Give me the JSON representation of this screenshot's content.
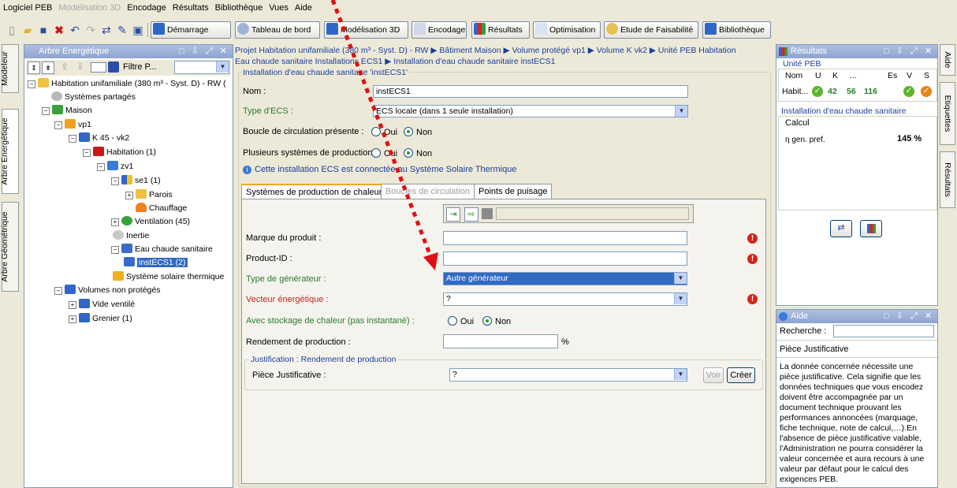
{
  "menu": {
    "items": [
      "Logiciel PEB",
      "Modélisation 3D",
      "Encodage",
      "Résultats",
      "Bibliothèque",
      "Vues",
      "Aide"
    ],
    "disabled": [
      false,
      true,
      false,
      false,
      false,
      false,
      false
    ]
  },
  "toolbar": {
    "buttons": [
      "Démarrage",
      "Tableau de bord",
      "Modélisation 3D",
      "Encodage",
      "Résultats",
      "Optimisation",
      "Etude de Faisabilité",
      "Bibliothèque"
    ]
  },
  "left_tabs": {
    "modeleur": "Modeleur",
    "arbre_energetique": "Arbre Energétique",
    "arbre_geometrique": "Arbre Géométrique"
  },
  "tree_panel": {
    "title": "Arbre Energétique",
    "filter_label": "Filtre P...",
    "nodes": [
      {
        "label": "Habitation unifamiliale (380 m³ - Syst. D) - RW (",
        "icon": "project-icon"
      },
      {
        "label": "Systèmes partagés",
        "icon": "gear-icon"
      },
      {
        "label": "Maison",
        "icon": "building-icon"
      },
      {
        "label": "vp1",
        "icon": "volume-icon"
      },
      {
        "label": "K 45 - vk2",
        "icon": "k-volume-icon"
      },
      {
        "label": "Habitation (1)",
        "icon": "cube-icon"
      },
      {
        "label": "zv1",
        "icon": "zone-icon"
      },
      {
        "label": "se1 (1)",
        "icon": "sector-icon"
      },
      {
        "label": "Parois",
        "icon": "wall-icon"
      },
      {
        "label": "Chauffage",
        "icon": "flame-icon"
      },
      {
        "label": "Ventilation (45)",
        "icon": "fan-icon"
      },
      {
        "label": "Inertie",
        "icon": "inertia-icon"
      },
      {
        "label": "Eau chaude sanitaire",
        "icon": "tap-icon"
      },
      {
        "label": "instECS1 (2)",
        "icon": "tap-icon"
      },
      {
        "label": "Système solaire thermique",
        "icon": "solar-icon"
      },
      {
        "label": "Volumes non protégés",
        "icon": "cube-icon"
      },
      {
        "label": "Vide ventilé",
        "icon": "cube-icon"
      },
      {
        "label": "Grenier (1)",
        "icon": "cube-icon"
      }
    ]
  },
  "breadcrumb": {
    "line1": "Projet Habitation unifamiliale (380 m³ - Syst. D) - RW ▶ Bâtiment Maison ▶ Volume protégé vp1 ▶ Volume K vk2 ▶ Unité PEB Habitation",
    "line2": "Eau chaude sanitaire Installations ECS1 ▶ Installation d'eau chaude sanitaire instECS1"
  },
  "form": {
    "group_title": "Installation d'eau chaude sanitaire 'instECS1'",
    "nom_label": "Nom :",
    "nom_value": "instECS1",
    "type_label": "Type d'ECS :",
    "type_value": "ECS locale (dans 1 seule installation)",
    "boucle_label": "Boucle de circulation présente :",
    "plusieurs_label": "Plusieurs systèmes de production :",
    "oui": "Oui",
    "non": "Non",
    "info": "Cette installation ECS est connectée au Système Solaire Thermique",
    "tabs": [
      "Systèmes de production de chaleur",
      "Boucles de circulation",
      "Points de puisage"
    ],
    "marque_label": "Marque du produit :",
    "product_label": "Product-ID :",
    "type_gen_label": "Type de générateur :",
    "type_gen_value": "Autre générateur",
    "vecteur_label": "Vecteur énergétique :",
    "vecteur_value": "?",
    "stockage_label": "Avec stockage de chaleur (pas instantané) :",
    "rendement_label": "Rendement de production :",
    "percent": "%",
    "justif_title": "Justification : Rendement de production",
    "piece_label": "Pièce Justificative :",
    "piece_value": "?",
    "voir": "Voir",
    "creer": "Créer"
  },
  "results_panel": {
    "title": "Résultats",
    "unite_label": "Unité PEB",
    "headers": [
      "Nom",
      "U",
      "K",
      "...",
      "Es",
      "V",
      "S"
    ],
    "row": {
      "name": "Habit...",
      "k": "42",
      "dots": "56",
      "es": "116"
    },
    "install_title": "Installation d'eau chaude sanitaire",
    "calc_header": "Calcul",
    "calc_label": "η gen. pref.",
    "calc_value": "145 %"
  },
  "aide_panel": {
    "title": "Aide",
    "search_label": "Recherche :",
    "topic": "Pièce Justificative",
    "text": "La donnée concernée nécessite une pièce justificative. Cela signifie que les données techniques que vous encodez doivent être accompagnée par un document technique prouvant les performances annoncées (marquage, fiche technique, note de calcul,…).En l'absence de pièce justificative valable, l'Administration ne pourra considérer la valeur concernée et aura recours à une valeur par défaut pour le calcul des exigences PEB."
  },
  "right_tabs": {
    "aide": "Aide",
    "etiquettes": "Etiquettes",
    "resultats": "Résultats"
  },
  "colors": {
    "accent": "#316ac5",
    "error": "#d5241b",
    "arrow": "#e01010",
    "green_label": "#2a7d2a"
  }
}
